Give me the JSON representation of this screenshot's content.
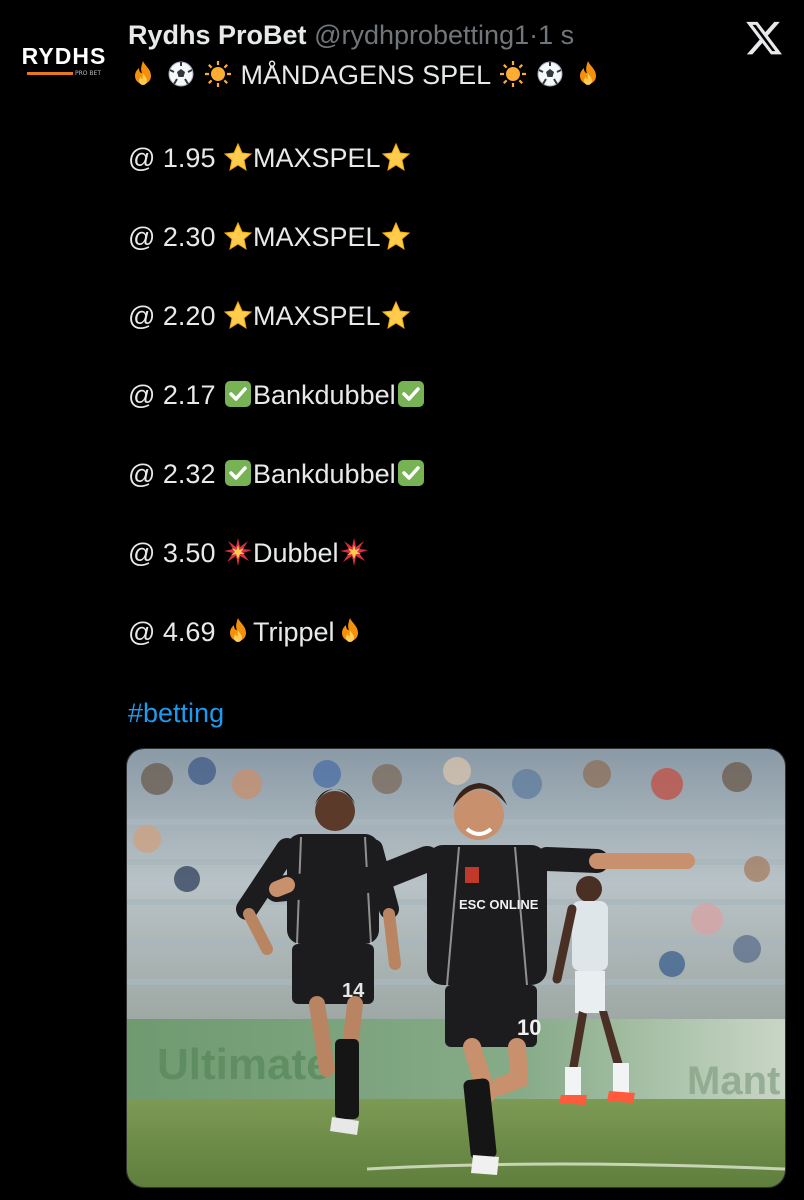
{
  "author": {
    "avatar_text": "RYDHS",
    "avatar_subtext": "PRO BET",
    "display_name": "Rydhs ProBet",
    "handle": "@rydhprobetting1",
    "separator": "·",
    "time": "1 s"
  },
  "tweet": {
    "title": "MÅNDAGENS SPEL",
    "bets": [
      {
        "odds": "@ 1.95",
        "label": "MAXSPEL",
        "icon": "star-icon"
      },
      {
        "odds": "@ 2.30",
        "label": "MAXSPEL",
        "icon": "star-icon"
      },
      {
        "odds": "@ 2.20",
        "label": "MAXSPEL",
        "icon": "star-icon"
      },
      {
        "odds": "@ 2.17",
        "label": "Bankdubbel",
        "icon": "check-icon"
      },
      {
        "odds": "@ 2.32",
        "label": "Bankdubbel",
        "icon": "check-icon"
      },
      {
        "odds": "@ 3.50",
        "label": "Dubbel",
        "icon": "collision-icon"
      },
      {
        "odds": "@ 4.69",
        "label": "Trippel",
        "icon": "fire-icon"
      }
    ],
    "hashtag": "#betting"
  },
  "media": {
    "shirt_sponsor": "ESC ONLINE",
    "player_numbers": [
      "14",
      "10"
    ],
    "ad_board_text": [
      "Ultimate",
      "Mant"
    ]
  },
  "colors": {
    "background": "#000000",
    "text": "#e7e9ea",
    "muted": "#71767b",
    "link": "#1d9bf0",
    "brand_orange": "#e8781e"
  }
}
